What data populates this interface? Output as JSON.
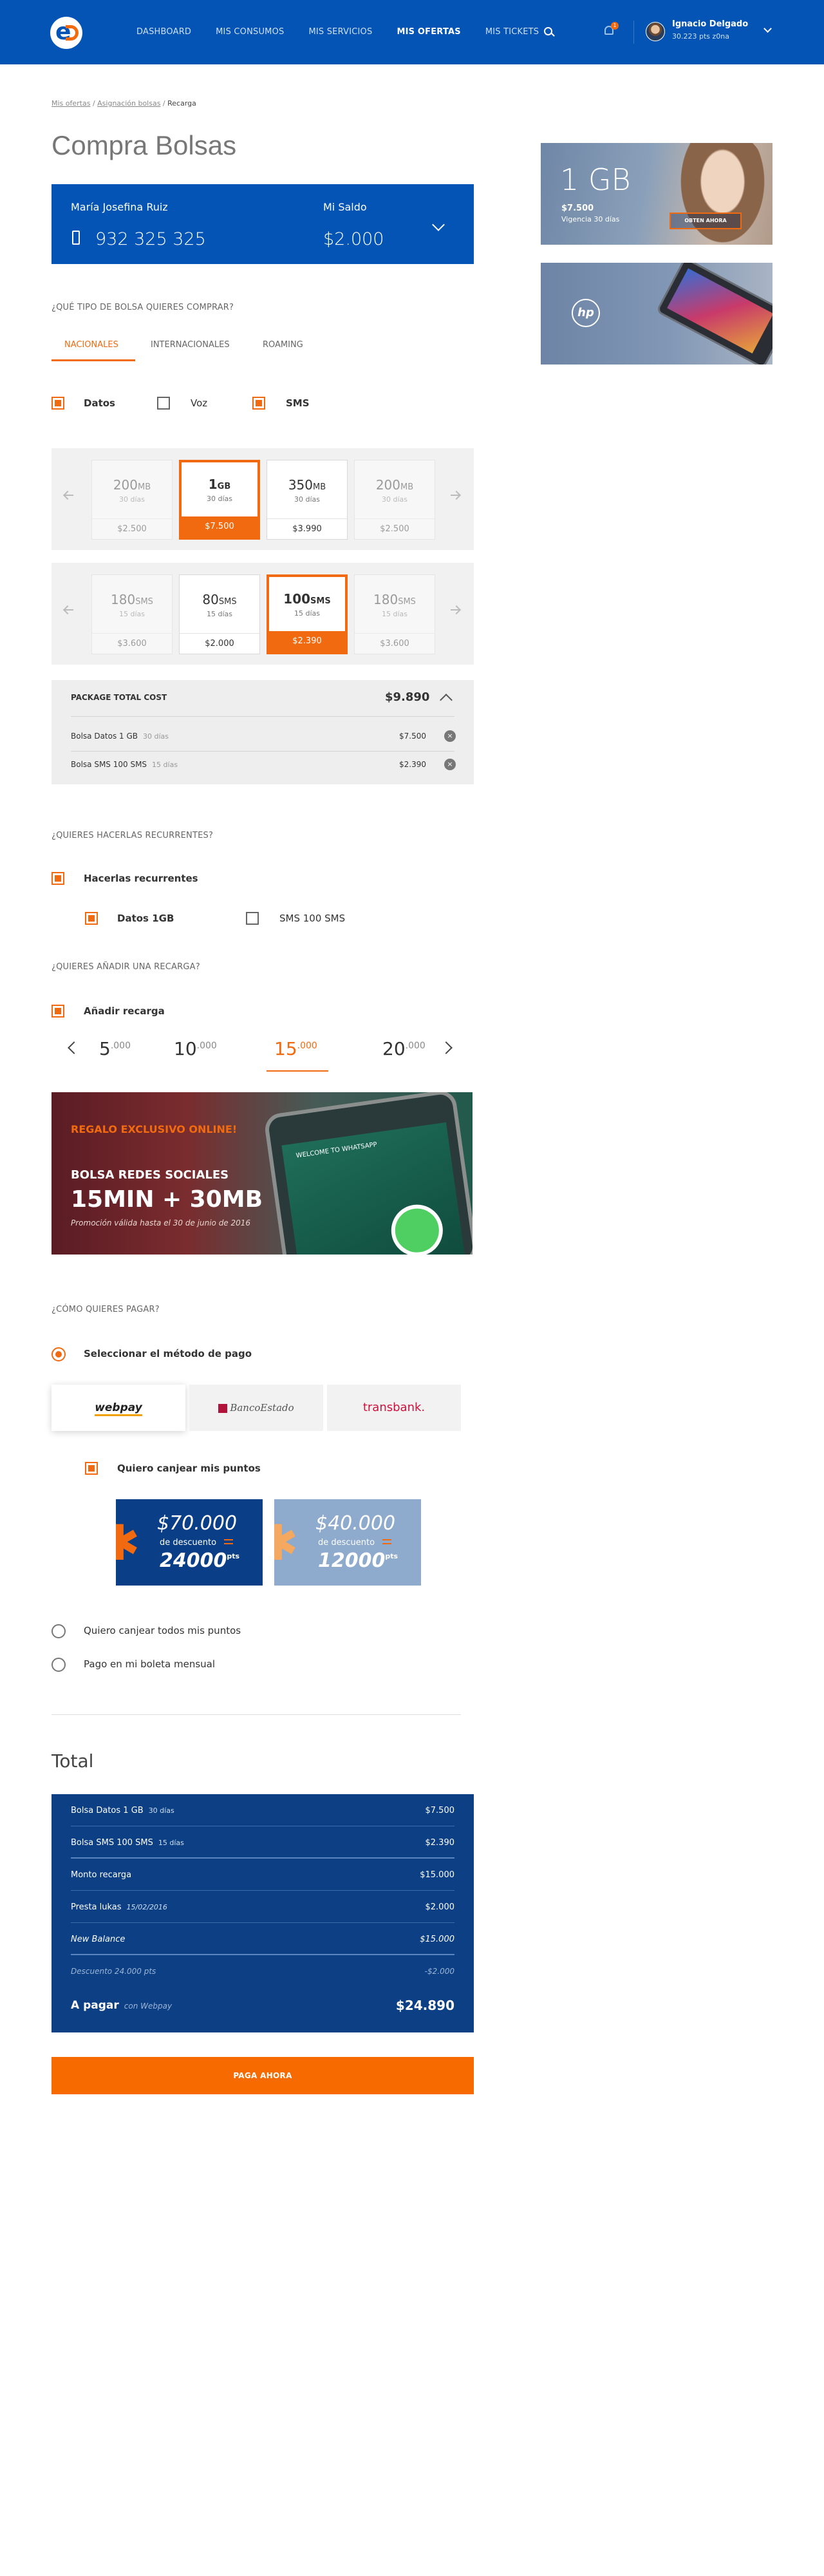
{
  "header": {
    "nav": [
      "DASHBOARD",
      "MIS CONSUMOS",
      "MIS SERVICIOS",
      "MIS OFERTAS",
      "MIS TICKETS"
    ],
    "active_nav": "MIS OFERTAS",
    "notifications": "1",
    "user_name": "Ignacio Delgado",
    "user_points": "30.223 pts z0na"
  },
  "breadcrumb": [
    "Mis ofertas",
    "Asignación bolsas",
    "Recarga"
  ],
  "page_title": "Compra Bolsas",
  "account": {
    "name": "María Josefina Ruiz",
    "phone": "932 325 325",
    "balance_label": "Mi Saldo",
    "balance": "$2.000"
  },
  "bag_type": {
    "question": "¿QUÉ TIPO DE BOLSA QUIERES COMPRAR?",
    "tabs": [
      "NACIONALES",
      "INTERNACIONALES",
      "ROAMING"
    ],
    "filters": [
      {
        "label": "Datos",
        "checked": true
      },
      {
        "label": "Voz",
        "checked": false
      },
      {
        "label": "SMS",
        "checked": true
      }
    ]
  },
  "data_plans": [
    {
      "amount": "200",
      "unit": "MB",
      "duration": "30 días",
      "price": "$2.500",
      "state": "dim"
    },
    {
      "amount": "1",
      "unit": "GB",
      "duration": "30 días",
      "price": "$7.500",
      "state": "selected"
    },
    {
      "amount": "350",
      "unit": "MB",
      "duration": "30 días",
      "price": "$3.990",
      "state": "normal"
    },
    {
      "amount": "200",
      "unit": "MB",
      "duration": "30 días",
      "price": "$2.500",
      "state": "dim"
    }
  ],
  "sms_plans": [
    {
      "amount": "180",
      "unit": "SMS",
      "duration": "15 días",
      "price": "$3.600",
      "state": "dim"
    },
    {
      "amount": "80",
      "unit": "SMS",
      "duration": "15 días",
      "price": "$2.000",
      "state": "normal"
    },
    {
      "amount": "100",
      "unit": "SMS",
      "duration": "15 días",
      "price": "$2.390",
      "state": "selected"
    },
    {
      "amount": "180",
      "unit": "SMS",
      "duration": "15 días",
      "price": "$3.600",
      "state": "dim"
    }
  ],
  "package_total": {
    "label": "PACKAGE TOTAL COST",
    "total": "$9.890",
    "items": [
      {
        "name": "Bolsa Datos 1 GB",
        "duration": "30 días",
        "price": "$7.500",
        "remove": "×"
      },
      {
        "name": "Bolsa SMS 100 SMS",
        "duration": "15 días",
        "price": "$2.390",
        "remove": "×"
      }
    ]
  },
  "recurrent": {
    "question": "¿QUIERES HACERLAS RECURRENTES?",
    "main_label": "Hacerlas recurrentes",
    "options": [
      {
        "label": "Datos 1GB",
        "checked": true
      },
      {
        "label": "SMS 100 SMS",
        "checked": false
      }
    ]
  },
  "recharge": {
    "question": "¿QUIERES AÑADIR UNA RECARGA?",
    "label": "Añadir recarga",
    "amounts": [
      {
        "major": "5",
        "minor": ".000"
      },
      {
        "major": "10",
        "minor": ".000"
      },
      {
        "major": "15",
        "minor": ".000"
      },
      {
        "major": "20",
        "minor": ".000"
      }
    ],
    "selected_index": 2
  },
  "promo": {
    "kicker": "REGALO EXCLUSIVO ONLINE!",
    "title": "BOLSA REDES SOCIALES",
    "headline": "15MIN + 30MB",
    "note": "Promoción válida hasta el 30 de junio de 2016",
    "phone_text": "WELCOME TO WHATSAPP"
  },
  "payment": {
    "question": "¿CÓMO QUIERES PAGAR?",
    "method_label": "Seleccionar el método de pago",
    "methods": [
      "webpay",
      "BancoEstado",
      "transbank."
    ],
    "points_label": "Quiero canjear mis puntos",
    "point_offers": [
      {
        "value": "$70.000",
        "desc": "de descuento",
        "points": "24000",
        "unit": "pts"
      },
      {
        "value": "$40.000",
        "desc": "de descuento",
        "points": "12000",
        "unit": "pts"
      }
    ],
    "all_points_label": "Quiero canjear todos mis puntos",
    "bill_label": "Pago en mi boleta mensual"
  },
  "total": {
    "title": "Total",
    "rows": [
      {
        "label": "Bolsa Datos 1 GB",
        "detail": "30 días",
        "value": "$7.500"
      },
      {
        "label": "Bolsa SMS 100 SMS",
        "detail": "15 días",
        "value": "$2.390"
      },
      {
        "label": "Monto recarga",
        "detail": "",
        "value": "$15.000"
      },
      {
        "label": "Presta lukas",
        "detail": "15/02/2016",
        "value": "$2.000"
      },
      {
        "label": "New Balance",
        "detail": "",
        "value": "$15.000"
      },
      {
        "label": "Descuento 24.000 pts",
        "detail": "",
        "value": "-$2.000"
      }
    ],
    "final_label": "A pagar",
    "final_detail": "con Webpay",
    "final_value": "$24.890"
  },
  "pay_button": "PAGA AHORA",
  "ads": {
    "ad1": {
      "headline": "1 GB",
      "price": "$7.500",
      "validity": "Vigencia 30 días",
      "cta": "OBTEN AHORA"
    },
    "ad2": {
      "brand": "hp"
    }
  },
  "colors": {
    "brand_blue": "#0354b4",
    "accent_orange": "#f26a10",
    "total_navy": "#0c3f84"
  }
}
